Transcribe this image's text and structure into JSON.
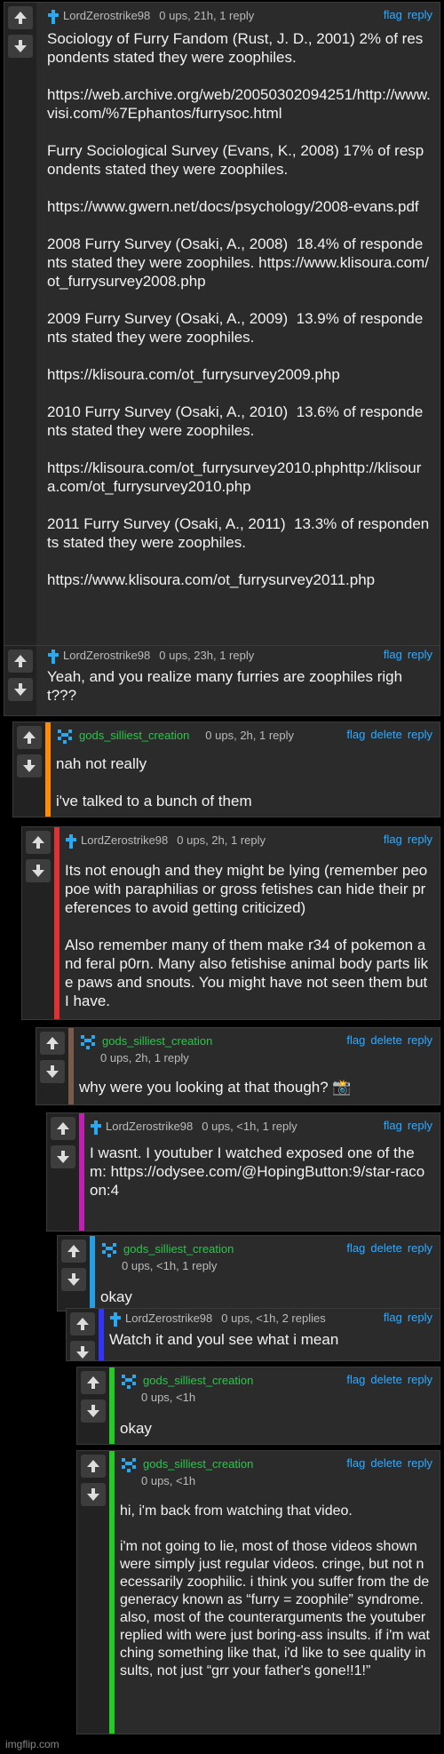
{
  "labels": {
    "flag": "flag",
    "delete": "delete",
    "reply": "reply"
  },
  "colors": {
    "link": "#33aaff",
    "username_green": "#22cc44",
    "accent_red": "#e03030",
    "accent_orange": "#ff8c00",
    "accent_brown": "#7a5a4a",
    "accent_magenta": "#c21fb2",
    "accent_cyan": "#1fa0e8",
    "accent_blue": "#3333ff",
    "accent_green": "#22cc22"
  },
  "comments": [
    {
      "user": "LordZerostrike98",
      "meta": "0 ups, 21h, 1 reply",
      "icon": "cross-icon",
      "text": "Sociology of Furry Fandom (Rust, J. D., 2001) 2% of respondents stated they were zoophiles.\n\nhttps://web.archive.org/web/20050302094251/http://www.visi.com/%7Ephantos/furrysoc.html\n\nFurry Sociological Survey (Evans, K., 2008) 17% of respondents stated they were zoophiles.\n\nhttps://www.gwern.net/docs/psychology/2008-evans.pdf\n\n2008 Furry Survey (Osaki, A., 2008)  18.4% of respondents stated they were zoophiles. https://www.klisoura.com/ot_furrysurvey2008.php\n\n2009 Furry Survey (Osaki, A., 2009)  13.9% of respondents stated they were zoophiles.\n\nhttps://klisoura.com/ot_furrysurvey2009.php\n\n2010 Furry Survey (Osaki, A., 2010)  13.6% of respondents stated they were zoophiles.\n\nhttps://klisoura.com/ot_furrysurvey2010.phphttp://klisoura.com/ot_furrysurvey2010.php\n\n2011 Furry Survey (Osaki, A., 2011)  13.3% of respondents stated they were zoophiles.\n\nhttps://www.klisoura.com/ot_furrysurvey2011.php"
    },
    {
      "user": "LordZerostrike98",
      "meta": "0 ups, 23h, 1 reply",
      "icon": "cross-icon",
      "text": "Yeah, and you realize many furries are zoophiles right???"
    },
    {
      "user": "gods_silliest_creation",
      "meta": "0 ups, 2h, 1 reply",
      "icon": "pixel-avatar-icon",
      "text": "nah not really\n\ni've talked to a bunch of them"
    },
    {
      "user": "LordZerostrike98",
      "meta": "0 ups, 2h, 1 reply",
      "icon": "cross-icon",
      "text": "Its not enough and they might be lying (remember peopoe with paraphilias or gross fetishes can hide their preferences to avoid getting criticized)\n\nAlso remember many of them make r34 of pokemon and feral p0rn. Many also fetishise animal body parts like paws and snouts. You might have not seen them but I have."
    },
    {
      "user": "gods_silliest_creation",
      "meta": "0 ups, 2h, 1 reply",
      "icon": "pixel-avatar-icon",
      "text": "why were you looking at that though? 📸"
    },
    {
      "user": "LordZerostrike98",
      "meta": "0 ups, <1h, 1 reply",
      "icon": "cross-icon",
      "text": "I wasnt. I youtuber I watched exposed one of them: https://odysee.com/@HopingButton:9/star-racoon:4"
    },
    {
      "user": "gods_silliest_creation",
      "meta": "0 ups, <1h, 1 reply",
      "icon": "pixel-avatar-icon",
      "text": "okay"
    },
    {
      "user": "LordZerostrike98",
      "meta": "0 ups, <1h, 2 replies",
      "icon": "cross-icon",
      "text": "Watch it and youl see what i mean"
    },
    {
      "user": "gods_silliest_creation",
      "meta": "0 ups, <1h",
      "icon": "pixel-avatar-icon",
      "text": "okay"
    },
    {
      "user": "gods_silliest_creation",
      "meta": "0 ups, <1h",
      "icon": "pixel-avatar-icon",
      "text": "hi, i'm back from watching that video.\n\ni'm not going to lie, most of those videos shown were simply just regular videos. cringe, but not necessarily zoophilic. i think you suffer from the degeneracy known as “furry = zoophile” syndrome. also, most of the counterarguments the youtuber replied with were just boring-ass insults. if i'm watching something like that, i'd like to see quality insults, not just “grr your father's gone!!1!”"
    }
  ],
  "footer": "imgflip.com"
}
